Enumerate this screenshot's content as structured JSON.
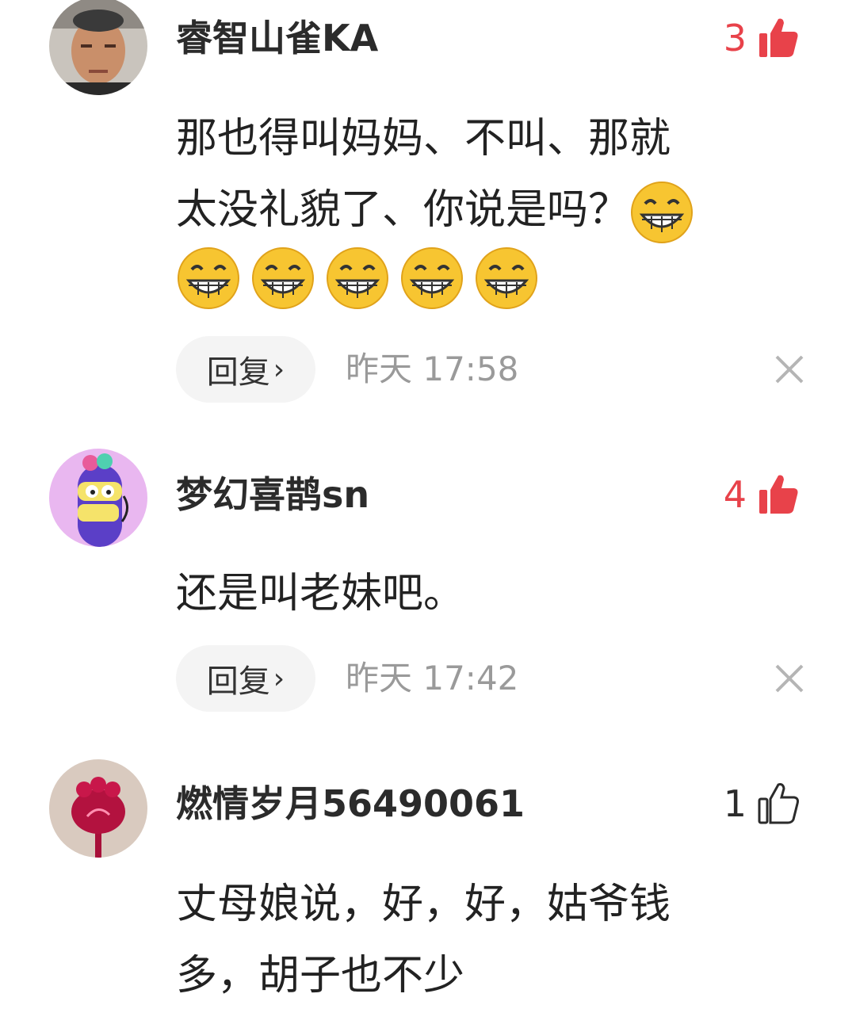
{
  "comments": [
    {
      "username": "睿智山雀KA",
      "likes": "3",
      "liked": true,
      "text_line1": "那也得叫妈妈、不叫、那就",
      "text_line2": "太没礼貌了、你说是吗？",
      "emoji": "grinning-face",
      "reply_label": "回复",
      "reply_chevron": "›",
      "time": "昨天  17:58"
    },
    {
      "username": "梦幻喜鹊sn",
      "likes": "4",
      "liked": true,
      "text_line1": "还是叫老妹吧。",
      "reply_label": "回复",
      "reply_chevron": "›",
      "time": "昨天  17:42"
    },
    {
      "username": "燃情岁月56490061",
      "likes": "1",
      "liked": false,
      "text_line1": "丈母娘说，好，好，姑爷钱",
      "text_line2": "多，胡子也不少"
    }
  ],
  "colors": {
    "like_active": "#e8424a",
    "reply_bg": "#f4f4f4",
    "time_text": "#9a9a9a"
  }
}
